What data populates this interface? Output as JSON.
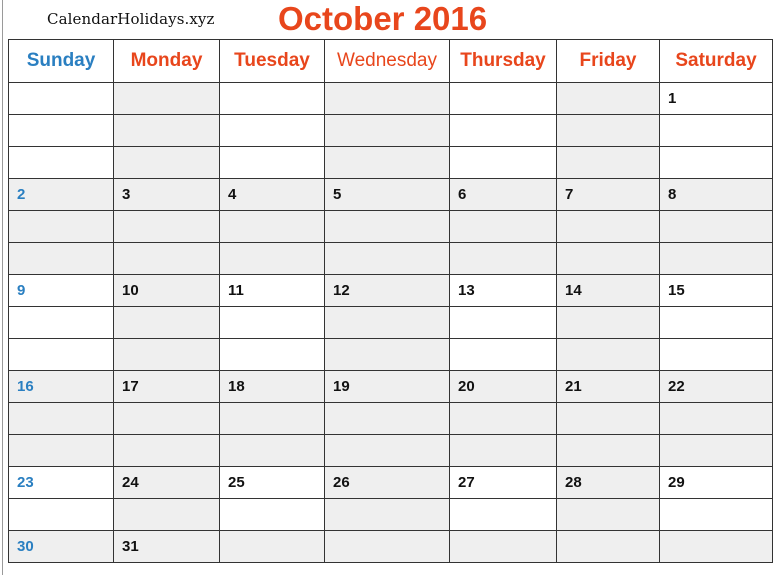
{
  "site_name": "CalendarHolidays.xyz",
  "title": "October 2016",
  "colors": {
    "title": "#e8461c",
    "sunday": "#2a7fc1",
    "weekday_header": "#e8461c",
    "shade": "#efefef",
    "grid": "#333333"
  },
  "weekdays": [
    "Sunday",
    "Monday",
    "Tuesday",
    "Wednesday",
    "Thursday",
    "Friday",
    "Saturday"
  ],
  "weeks": [
    [
      "",
      "",
      "",
      "",
      "",
      "",
      "1"
    ],
    [
      "2",
      "3",
      "4",
      "5",
      "6",
      "7",
      "8"
    ],
    [
      "9",
      "10",
      "11",
      "12",
      "13",
      "14",
      "15"
    ],
    [
      "16",
      "17",
      "18",
      "19",
      "20",
      "21",
      "22"
    ],
    [
      "23",
      "24",
      "25",
      "26",
      "27",
      "28",
      "29"
    ],
    [
      "30",
      "31",
      "",
      "",
      "",
      "",
      ""
    ]
  ]
}
